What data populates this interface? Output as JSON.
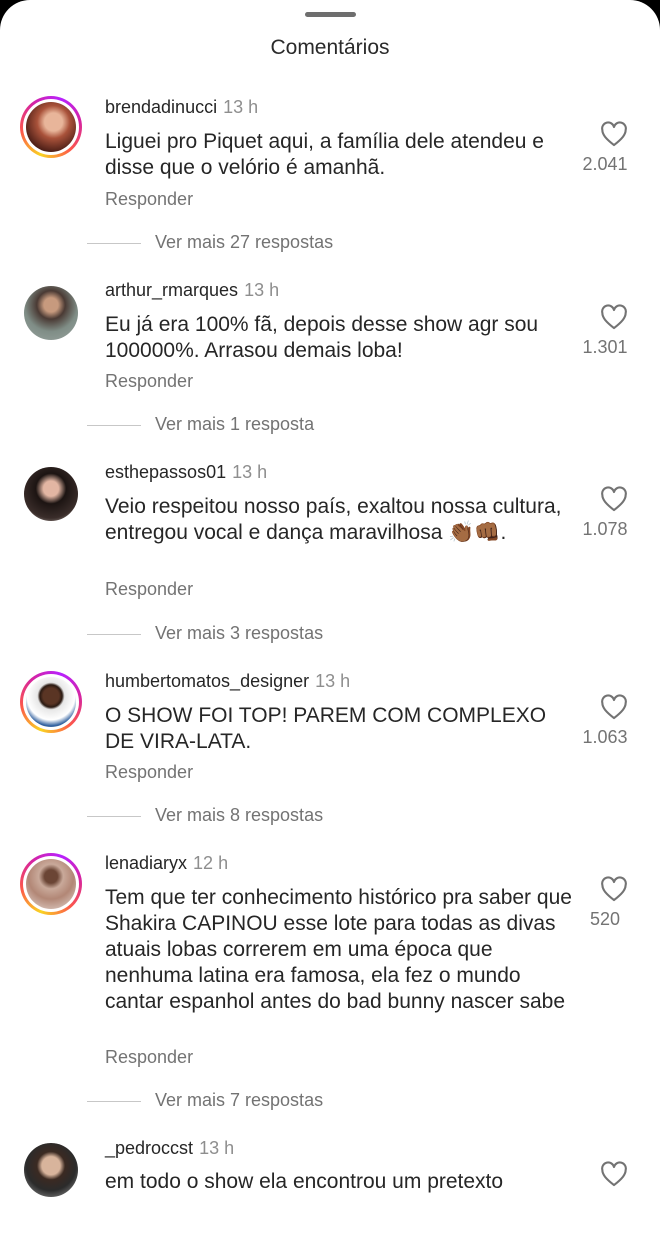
{
  "header": {
    "title": "Comentários"
  },
  "comments": [
    {
      "username": "brendadinucci",
      "time": "13 h",
      "text": "Liguei pro Piquet aqui, a família dele atendeu e disse que o velório é amanhã.",
      "likes": "2.041",
      "reply": "Responder",
      "more": "Ver mais 27 respostas"
    },
    {
      "username": "arthur_rmarques",
      "time": "13 h",
      "text": "Eu já era 100% fã, depois desse show agr sou 100000%. Arrasou demais loba!",
      "likes": "1.301",
      "reply": "Responder",
      "more": "Ver mais 1 resposta"
    },
    {
      "username": "esthepassos01",
      "time": "13 h",
      "text": "Veio respeitou nosso país, exaltou nossa cultura, entregou vocal e dança maravilhosa 👏🏾👊🏾.",
      "likes": "1.078",
      "reply": "Responder",
      "more": "Ver mais 3 respostas"
    },
    {
      "username": "humbertomatos_designer",
      "time": "13 h",
      "text": "O SHOW FOI TOP! PAREM COM COMPLEXO DE VIRA-LATA.",
      "likes": "1.063",
      "reply": "Responder",
      "more": "Ver mais 8 respostas"
    },
    {
      "username": "lenadiaryx",
      "time": "12 h",
      "text": "Tem que ter conhecimento histórico pra saber que Shakira CAPINOU esse lote para todas as divas atuais lobas correrem em uma época que nenhuma latina era famosa, ela fez o mundo cantar espanhol antes do bad bunny nascer sabe",
      "likes": "520",
      "reply": "Responder",
      "more": "Ver mais 7 respostas"
    },
    {
      "username": "_pedroccst",
      "time": "13 h",
      "text": "em todo o show ela encontrou um pretexto",
      "likes": "",
      "reply": "",
      "more": ""
    }
  ]
}
